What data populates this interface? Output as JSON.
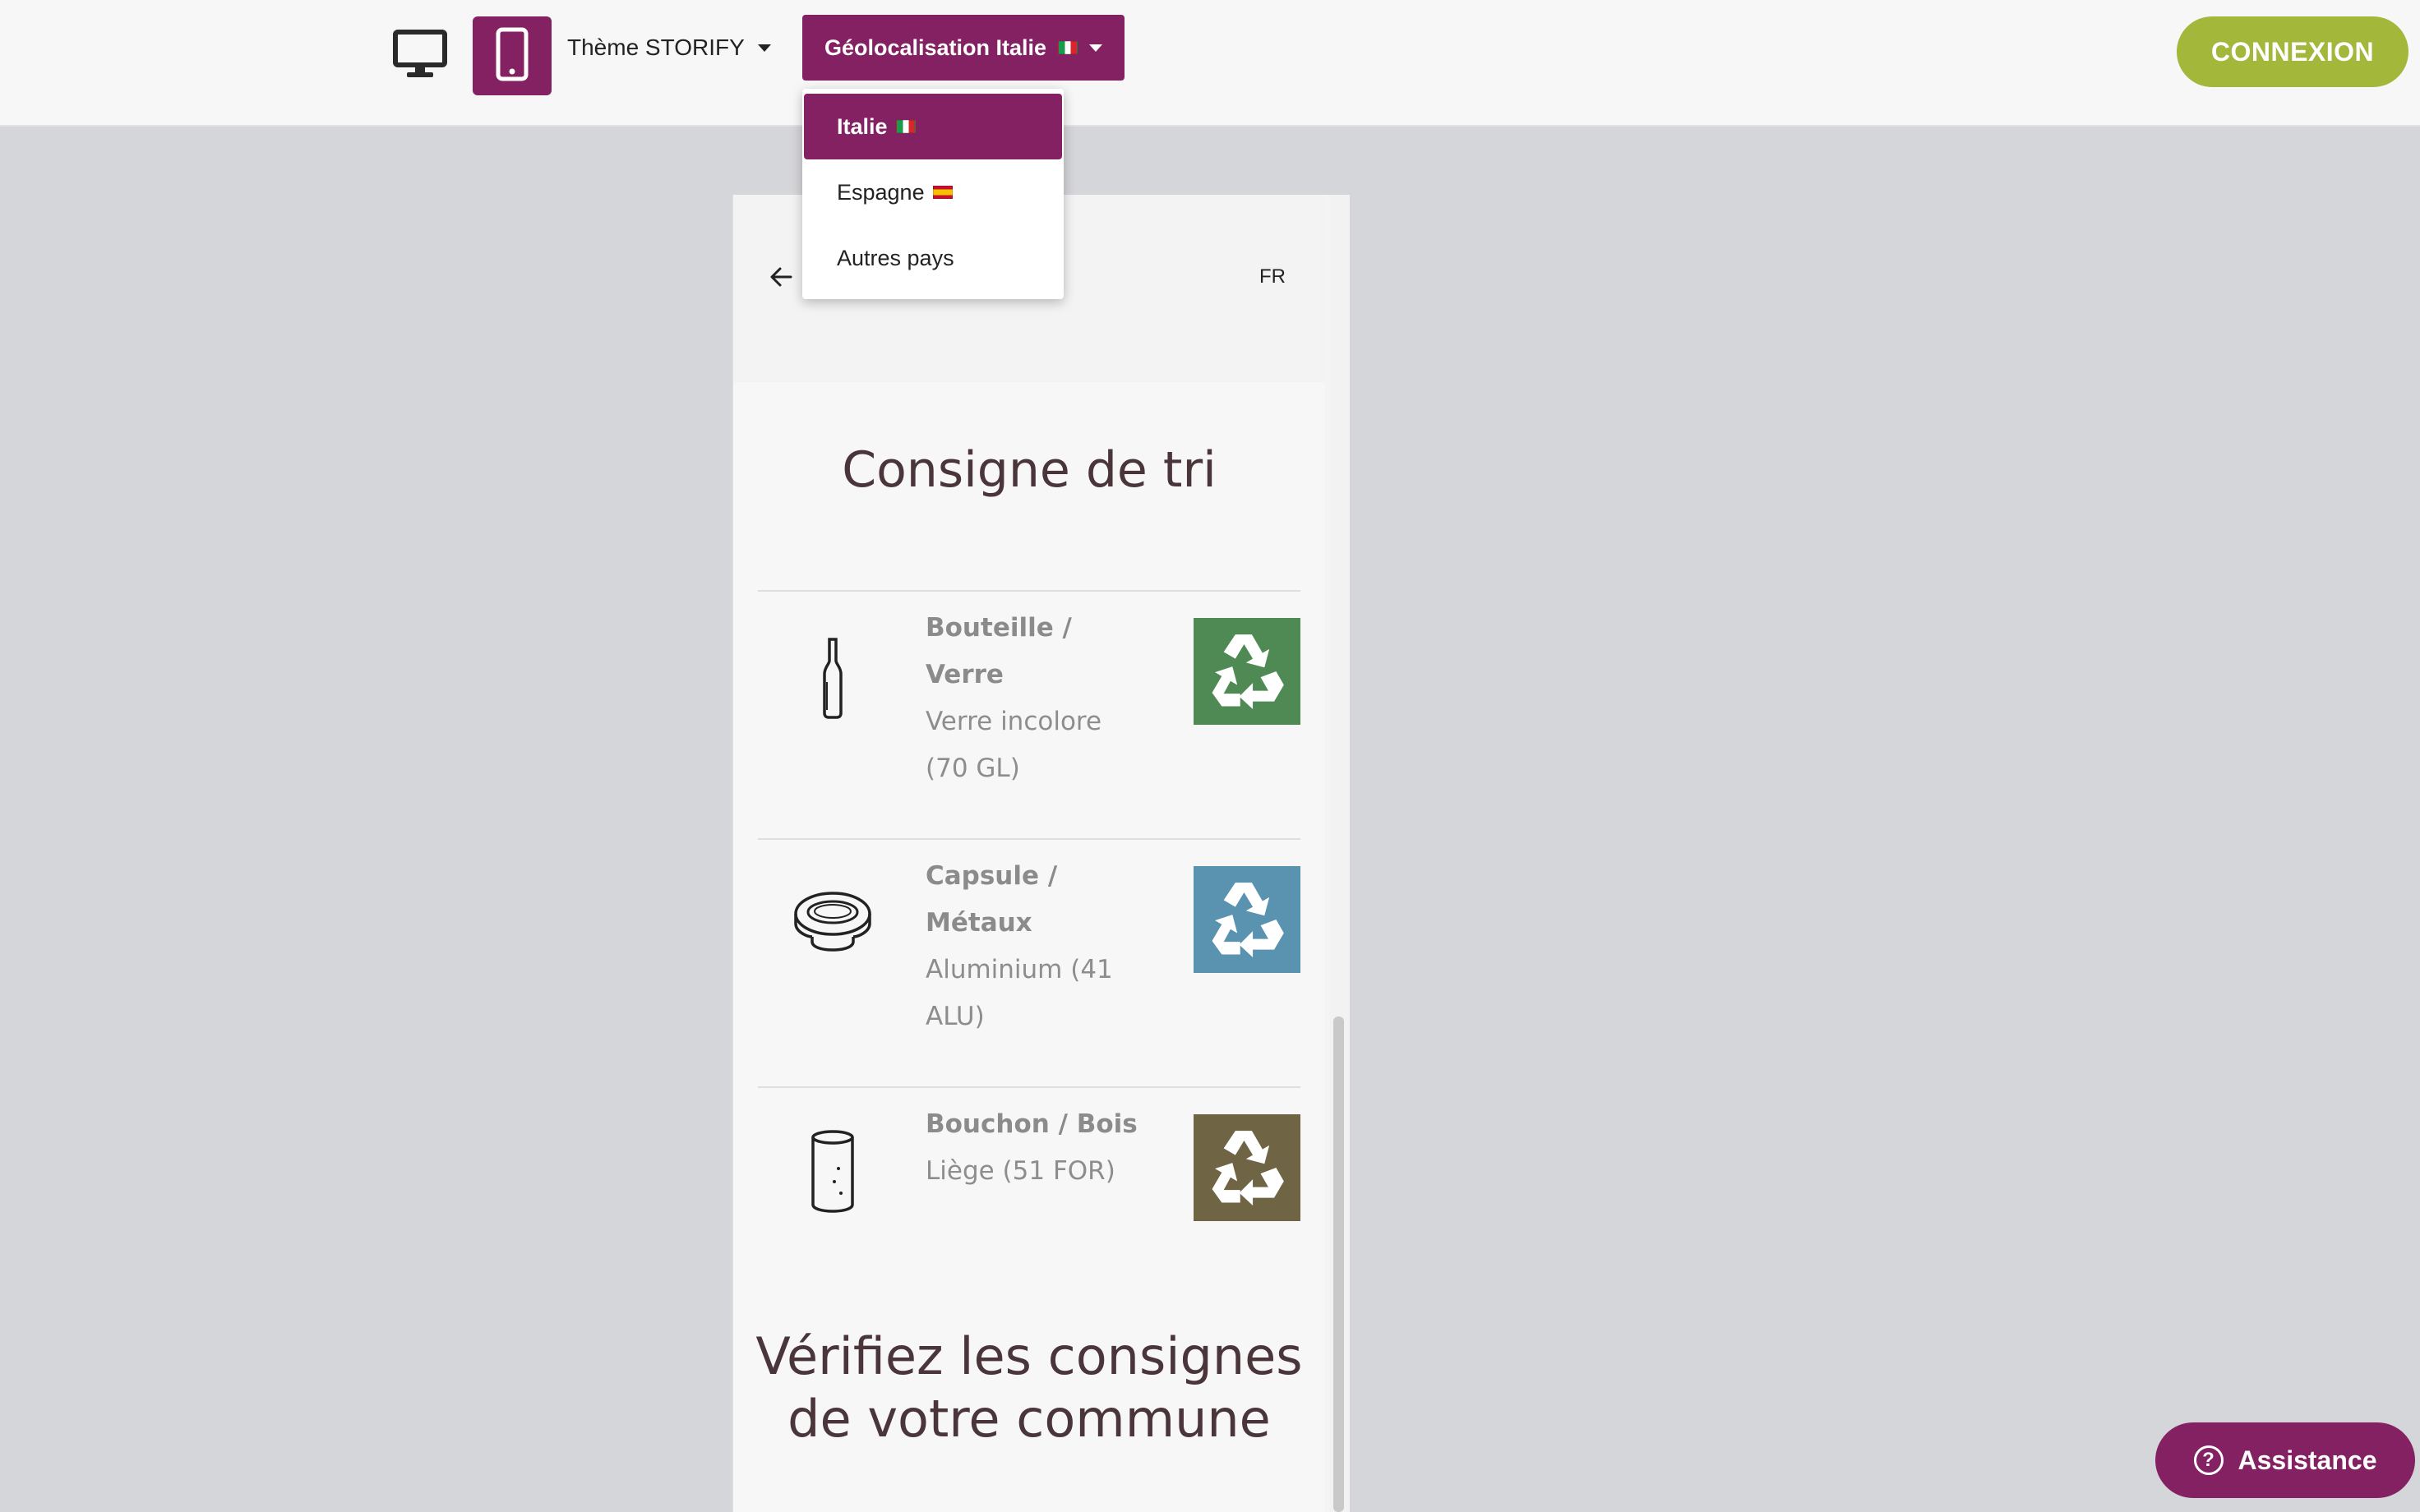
{
  "topbar": {
    "view_desktop_icon": "desktop-icon",
    "view_mobile_icon": "smartphone-icon",
    "theme_label": "Thème STORIFY",
    "geo_label": "Géolocalisation Italie",
    "login_label": "CONNEXION"
  },
  "geo_menu": {
    "items": [
      {
        "label": "Italie",
        "flag": "it",
        "active": true
      },
      {
        "label": "Espagne",
        "flag": "es",
        "active": false
      },
      {
        "label": "Autres pays",
        "flag": null,
        "active": false
      }
    ]
  },
  "preview": {
    "back_icon": "arrow-left-icon",
    "lang": "FR",
    "sorting_title": "Consigne de tri",
    "items": [
      {
        "name": "Bouteille / Verre",
        "name_lines": [
          "Bouteille /",
          "Verre"
        ],
        "material_lines": [
          "Verre incolore",
          "(70 GL)"
        ],
        "icon": "bottle-icon",
        "badge_color": "#4f8a55"
      },
      {
        "name": "Capsule / Métaux",
        "name_lines": [
          "Capsule /",
          "Métaux"
        ],
        "material_lines": [
          "Aluminium (41",
          "ALU)"
        ],
        "icon": "capsule-icon",
        "badge_color": "#5a93b0"
      },
      {
        "name": "Bouchon / Bois",
        "name_lines": [
          "Bouchon / Bois"
        ],
        "material_lines": [
          "Liège (51 FOR)"
        ],
        "icon": "cork-icon",
        "badge_color": "#6f6545"
      }
    ],
    "commune_title": "Vérifiez les consignes de votre commune",
    "commune_lines": [
      "Vérifiez les consignes",
      "de votre commune"
    ]
  },
  "assistance": {
    "label": "Assistance",
    "icon": "help-circle-icon"
  },
  "colors": {
    "brand": "#842162",
    "login": "#a3b73a",
    "background": "#d5d6d9"
  }
}
